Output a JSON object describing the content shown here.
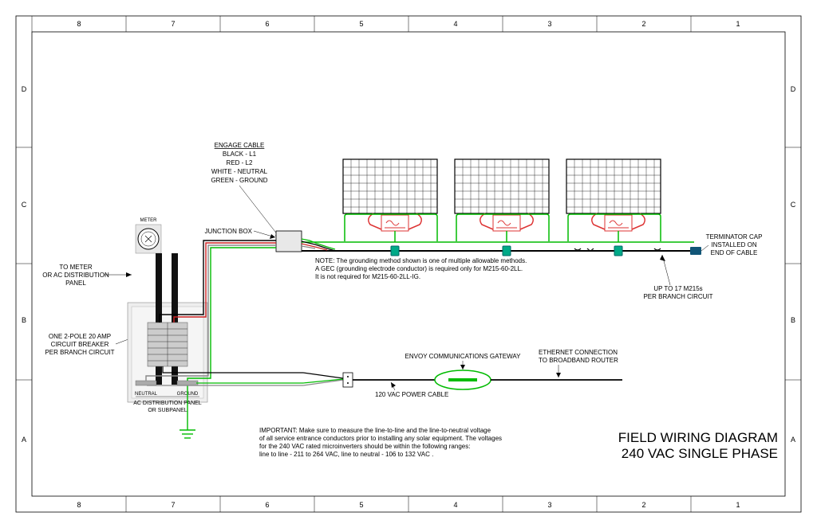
{
  "border": {
    "cols": [
      "8",
      "7",
      "6",
      "5",
      "4",
      "3",
      "2",
      "1"
    ],
    "rows": [
      "D",
      "C",
      "B",
      "A"
    ]
  },
  "title": {
    "line1": "FIELD WIRING DIAGRAM",
    "line2": "240 VAC SINGLE PHASE"
  },
  "labels": {
    "engage_header": "ENGAGE CABLE",
    "engage_l1": "BLACK - L1",
    "engage_l2": "RED - L2",
    "engage_n": "WHITE - NEUTRAL",
    "engage_g": "GREEN - GROUND",
    "junction_box": "JUNCTION BOX",
    "meter": "METER",
    "to_meter_1": "TO METER",
    "to_meter_2": "OR AC DISTRIBUTION",
    "to_meter_3": "PANEL",
    "breaker_1": "ONE 2-POLE 20 AMP",
    "breaker_2": "CIRCUIT BREAKER",
    "breaker_3": "PER BRANCH CIRCUIT",
    "neutral": "NEUTRAL",
    "ground": "GROUND",
    "dist_1": "AC DISTRIBUTION PANEL",
    "dist_2": "OR SUBPANEL",
    "envoy": "ENVOY COMMUNICATIONS GATEWAY",
    "power_cable": "120 VAC POWER CABLE",
    "ethernet_1": "ETHERNET CONNECTION",
    "ethernet_2": "TO BROADBAND ROUTER",
    "term_1": "TERMINATOR CAP",
    "term_2": "INSTALLED ON",
    "term_3": "END OF CABLE",
    "upto_1": "UP TO 17 M215s",
    "upto_2": "PER BRANCH CIRCUIT",
    "note_1": "NOTE: The grounding method shown is one of multiple allowable methods.",
    "note_2": "A GEC (grounding electrode conductor) is required only for M215-60-2LL.",
    "note_3": "It is not required for M215-60-2LL-IG.",
    "imp_1": "IMPORTANT: Make sure to measure the line-to-line and the line-to-neutral voltage",
    "imp_2": "of all service entrance conductors prior to installing any solar equipment. The voltages",
    "imp_3": "for the 240 VAC rated microinverters should be within the following ranges:",
    "imp_4": "line to line - 211 to 264 VAC, line to neutral - 106 to 132 VAC   ."
  }
}
